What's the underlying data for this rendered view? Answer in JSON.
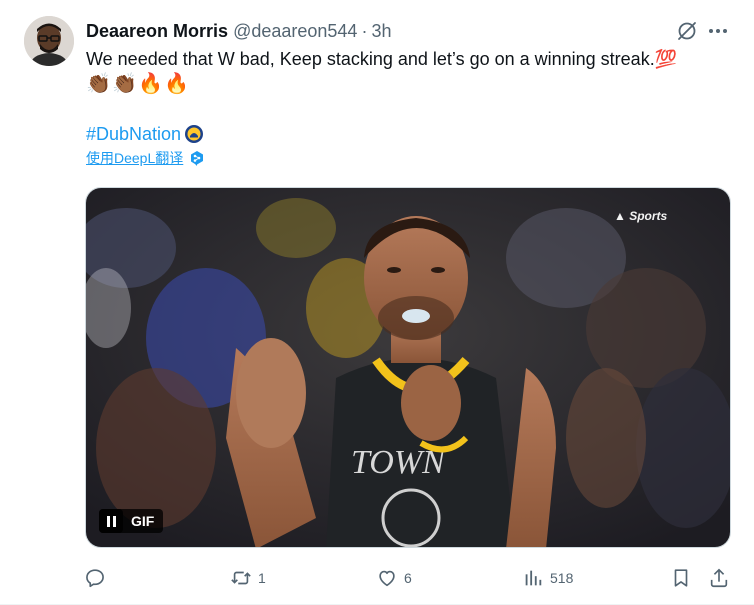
{
  "tweet": {
    "author_name": "Deaareon Morris",
    "author_handle": "@deaareon544",
    "separator": "·",
    "time": "3h",
    "text": "We needed that W bad, Keep stacking and let’s go on a winning streak.💯",
    "emojis": [
      "👏🏾",
      "👏🏾",
      "🔥",
      "🔥"
    ],
    "hashtag": "#DubNation",
    "translate_label": "使用DeepL翻译"
  },
  "media": {
    "badge_label": "GIF",
    "state": "playing"
  },
  "actions": {
    "reply_count": "",
    "retweet_count": "1",
    "like_count": "6",
    "views_count": "518"
  },
  "colors": {
    "accent": "#1d9bf0",
    "secondary_text": "#536471",
    "primary_text": "#0f1419"
  }
}
